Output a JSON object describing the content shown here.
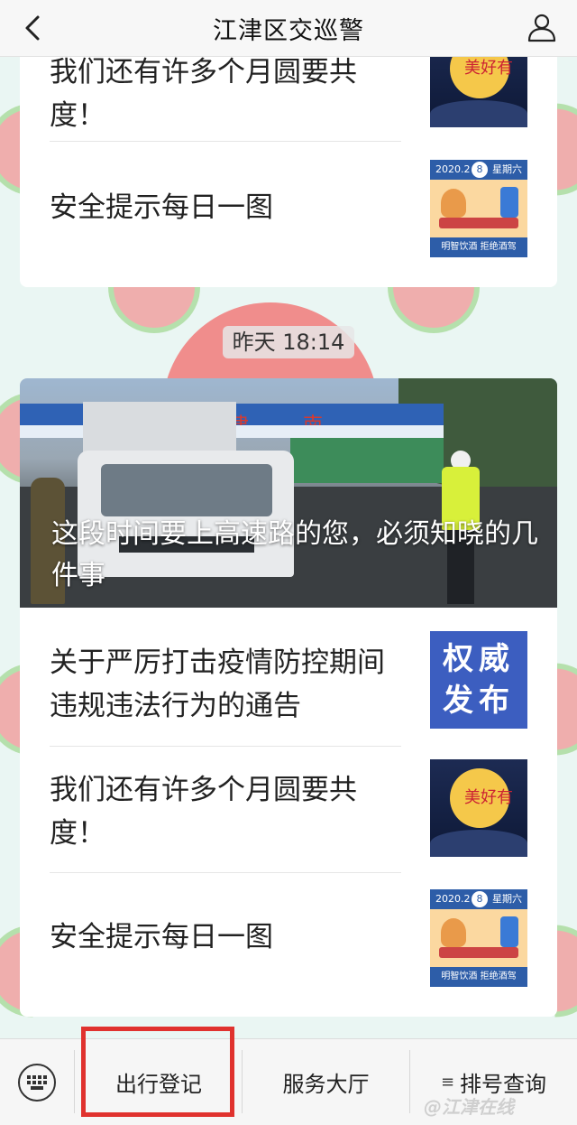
{
  "header": {
    "title": "江津区交巡警",
    "back_icon": "chevron-left-icon",
    "profile_icon": "person-icon"
  },
  "top_card": {
    "items": [
      {
        "text": "我们还有许多个月圆要共度！"
      },
      {
        "text": "安全提示每日一图"
      }
    ]
  },
  "timestamp": "昨天 18:14",
  "article_group": {
    "hero": {
      "caption": "这段时间要上高速路的您，必须知晓的几件事",
      "sign_text": "江津南"
    },
    "items": [
      {
        "text": "关于严厉打击疫情防控期间违规违法行为的通告",
        "thumb_text": "权威发布"
      },
      {
        "text": "我们还有许多个月圆要共度！"
      },
      {
        "text": "安全提示每日一图"
      }
    ]
  },
  "safety_thumb": {
    "date": "2020.2",
    "num": "8",
    "day": "星期六",
    "footer": "明智饮酒 拒绝酒驾"
  },
  "moon_thumb": {
    "text": "美好有"
  },
  "menu": {
    "keyboard_icon": "keyboard-icon",
    "items": [
      {
        "label": "出行登记"
      },
      {
        "label": "服务大厅"
      },
      {
        "label": "排号查询",
        "icon": "≡"
      }
    ]
  },
  "watermark": "@江津在线"
}
